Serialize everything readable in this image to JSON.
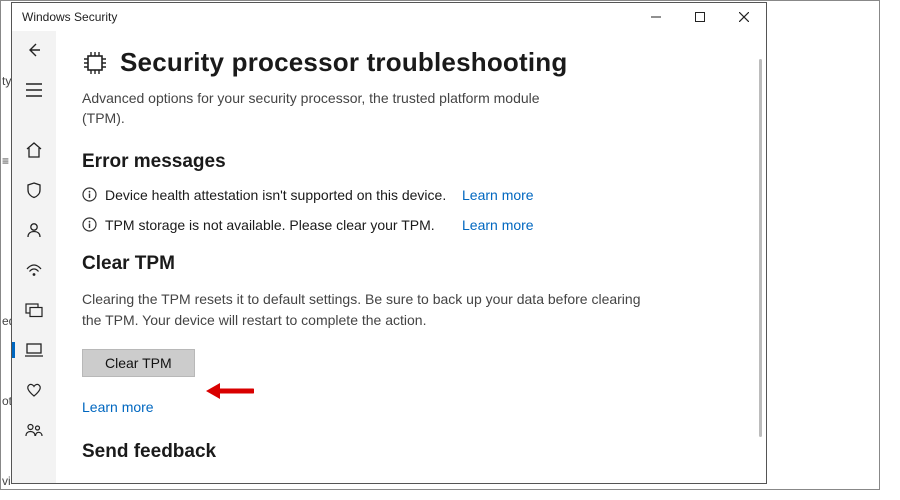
{
  "window": {
    "title": "Windows Security"
  },
  "sidebar": {
    "items": [
      {
        "name": "back"
      },
      {
        "name": "menu"
      },
      {
        "name": "home"
      },
      {
        "name": "virus-threat"
      },
      {
        "name": "account"
      },
      {
        "name": "firewall"
      },
      {
        "name": "app-browser"
      },
      {
        "name": "device-security",
        "active": true
      },
      {
        "name": "performance-health"
      },
      {
        "name": "family"
      }
    ]
  },
  "page": {
    "title": "Security processor troubleshooting",
    "subtitle": "Advanced options for your security processor, the trusted platform module (TPM).",
    "errors": {
      "heading": "Error messages",
      "items": [
        {
          "msg": "Device health attestation isn't supported on this device.",
          "link": "Learn more"
        },
        {
          "msg": "TPM storage is not available. Please clear your TPM.",
          "link": "Learn more"
        }
      ]
    },
    "clear": {
      "heading": "Clear TPM",
      "desc": "Clearing the TPM resets it to default settings. Be sure to back up your data before clearing the TPM. Your device will restart to complete the action.",
      "button": "Clear TPM",
      "learn_more": "Learn more"
    },
    "feedback": {
      "heading": "Send feedback"
    }
  }
}
